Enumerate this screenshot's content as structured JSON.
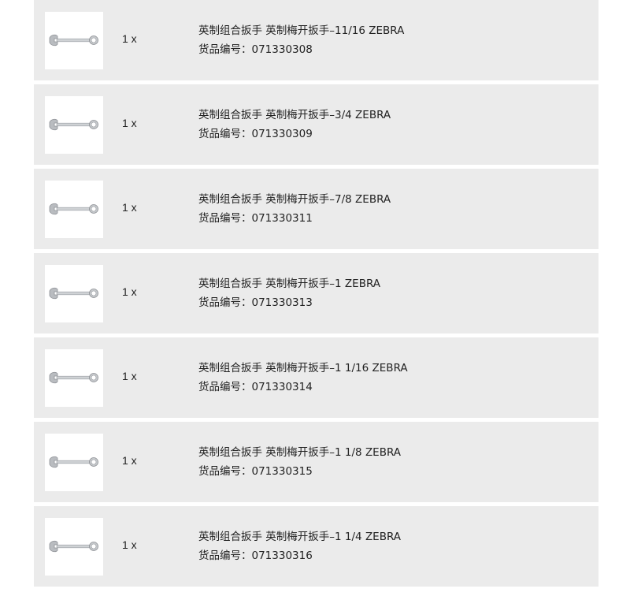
{
  "items": [
    {
      "qty": "1 x",
      "title": "英制组合扳手 英制梅开扳手–11/16 ZEBRA",
      "code_label": "货品编号：",
      "code": "071330308",
      "icon": "combination-wrench-icon"
    },
    {
      "qty": "1 x",
      "title": "英制组合扳手 英制梅开扳手–3/4 ZEBRA",
      "code_label": "货品编号：",
      "code": "071330309",
      "icon": "combination-wrench-icon"
    },
    {
      "qty": "1 x",
      "title": "英制组合扳手 英制梅开扳手–7/8 ZEBRA",
      "code_label": "货品编号：",
      "code": "071330311",
      "icon": "combination-wrench-icon"
    },
    {
      "qty": "1 x",
      "title": "英制组合扳手 英制梅开扳手–1 ZEBRA",
      "code_label": "货品编号：",
      "code": "071330313",
      "icon": "combination-wrench-icon"
    },
    {
      "qty": "1 x",
      "title": "英制组合扳手 英制梅开扳手–1 1/16 ZEBRA",
      "code_label": "货品编号：",
      "code": "071330314",
      "icon": "combination-wrench-icon"
    },
    {
      "qty": "1 x",
      "title": "英制组合扳手 英制梅开扳手–1 1/8 ZEBRA",
      "code_label": "货品编号：",
      "code": "071330315",
      "icon": "combination-wrench-icon"
    },
    {
      "qty": "1 x",
      "title": "英制组合扳手 英制梅开扳手–1 1/4 ZEBRA",
      "code_label": "货品编号：",
      "code": "071330316",
      "icon": "combination-wrench-icon"
    }
  ],
  "colors": {
    "row_background": "#ebebeb",
    "text": "#222222",
    "thumbnail_background": "#ffffff"
  }
}
